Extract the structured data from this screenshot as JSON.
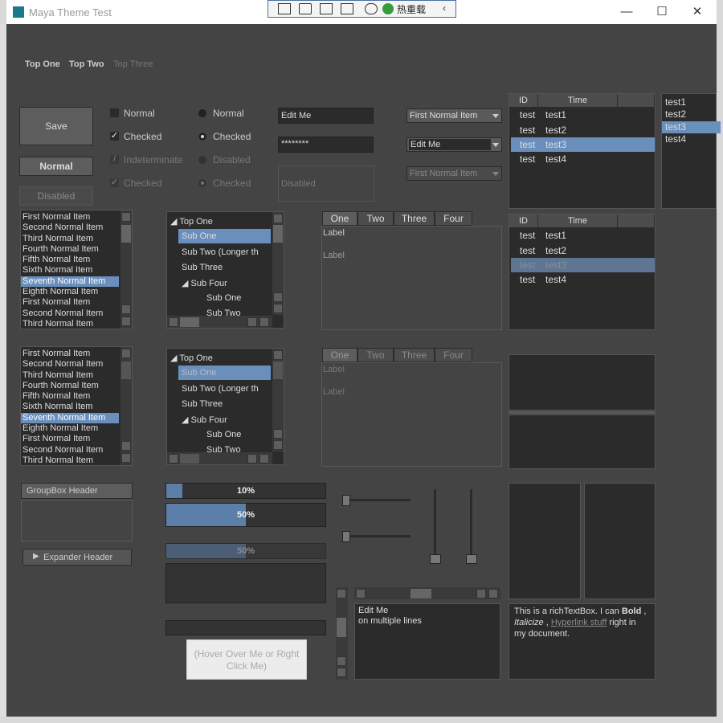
{
  "window": {
    "title": "Maya Theme Test",
    "hot_reload_label": "热重载",
    "controls": [
      "—",
      "☐",
      "✕"
    ]
  },
  "nav": [
    "Top One",
    "Top Two",
    "Top Three"
  ],
  "buttons": {
    "save": "Save",
    "normal": "Normal",
    "disabled": "Disabled"
  },
  "checkboxes": [
    "Normal",
    "Checked",
    "Indeterminate",
    "Checked"
  ],
  "radios": [
    "Normal",
    "Checked",
    "Disabled",
    "Checked"
  ],
  "inputs": {
    "edit_value": "Edit Me",
    "password_value": "********",
    "disabled_text": "Disabled"
  },
  "combos": [
    "First Normal Item",
    "Edit Me",
    "First Normal Item"
  ],
  "grid": {
    "headers": [
      "ID",
      "Time"
    ],
    "rows": [
      [
        "test",
        "test1"
      ],
      [
        "test",
        "test2"
      ],
      [
        "test",
        "test3"
      ],
      [
        "test",
        "test4"
      ]
    ]
  },
  "small_list": [
    "test1",
    "test2",
    "test3",
    "test4"
  ],
  "list_items": [
    "First Normal Item",
    "Second Normal Item",
    "Third Normal Item",
    "Fourth Normal Item",
    "Fifth Normal Item",
    "Sixth Normal Item",
    "Seventh Normal Item",
    "Eighth Normal Item",
    "First Normal Item",
    "Second Normal Item",
    "Third Normal Item"
  ],
  "tree": [
    "Top One",
    "Sub One",
    "Sub Two (Longer th",
    "Sub Three",
    "Sub Four",
    "Sub One",
    "Sub Two"
  ],
  "tabs": [
    "One",
    "Two",
    "Three",
    "Four"
  ],
  "tab_labels": [
    "Label",
    "Label"
  ],
  "groupbox_header": "GroupBox Header",
  "expander_header": "Expander Header",
  "progress": [
    {
      "label": "10%",
      "value": 0.1
    },
    {
      "label": "50%",
      "value": 0.5
    },
    {
      "label": "50%",
      "value": 0.5
    }
  ],
  "hover_button": "(Hover Over Me or Right Click Me)",
  "multiline": [
    "Edit Me",
    "on multiple lines"
  ],
  "rich": {
    "t1": "This is a richTextBox. I can ",
    "bold": "Bold",
    "t2": " , ",
    "italic": "Italicize",
    "t3": " , ",
    "link": "Hyperlink stuff",
    "t4": " right in my document."
  }
}
